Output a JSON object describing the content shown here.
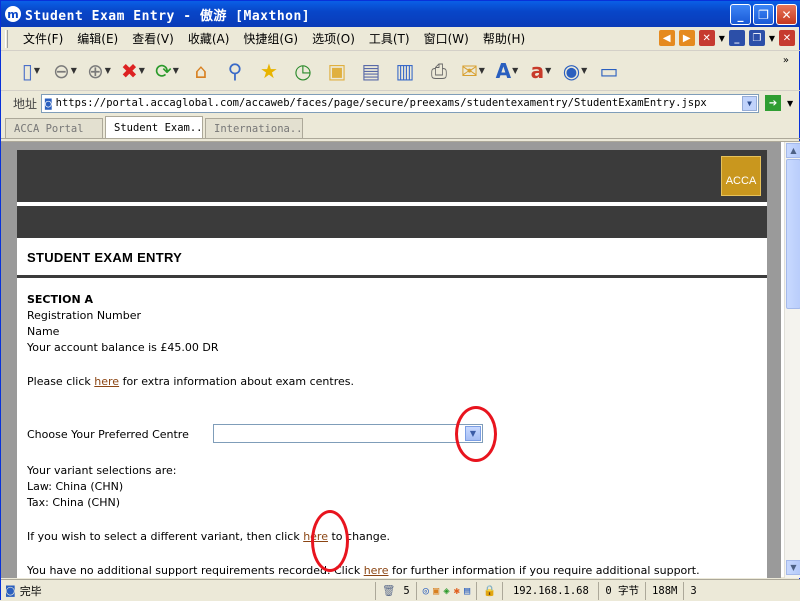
{
  "window": {
    "title": "Student Exam Entry - 傲游 [Maxthon]",
    "app_icon": "m"
  },
  "menu": [
    "文件(F)",
    "编辑(E)",
    "查看(V)",
    "收藏(A)",
    "快捷组(G)",
    "选项(O)",
    "工具(T)",
    "窗口(W)",
    "帮助(H)"
  ],
  "address": {
    "label": "地址",
    "url": "https://portal.accaglobal.com/accaweb/faces/page/secure/preexams/studentexamentry/StudentExamEntry.jspx"
  },
  "tabs": [
    "ACCA Portal",
    "Student Exam...",
    "Internationa..."
  ],
  "page": {
    "logo": "ACCA",
    "heading": "STUDENT EXAM ENTRY",
    "section": "SECTION A",
    "registration_label": "Registration Number",
    "name_label": "Name",
    "balance_text": "Your account balance is £45.00 DR",
    "centre_info_pre": "Please click ",
    "centre_info_link": "here",
    "centre_info_post": " for extra information about exam centres.",
    "preferred_centre_label": "Choose Your Preferred Centre",
    "preferred_centre_value": "",
    "variant_intro": "Your variant selections are:",
    "variant_law": "Law: China (CHN)",
    "variant_tax": "Tax: China (CHN)",
    "variant_change_pre": "If you wish to select a different variant, then click ",
    "variant_change_link": "here",
    "variant_change_post": " to change.",
    "support_pre": "You have no additional support requirements recorded. Click ",
    "support_link": "here",
    "support_post": " for further information if you require additional support."
  },
  "status": {
    "text": "完毕",
    "count": "5",
    "ip": "192.168.1.68",
    "bytes": "0 字节",
    "memory": "188M",
    "extra": "3"
  },
  "colors": {
    "title_bar": "#0846C8",
    "link": "#8B4513",
    "annotation_circle": "#E8141E",
    "logo": "#C9971E",
    "banner": "#3B3B3B"
  }
}
